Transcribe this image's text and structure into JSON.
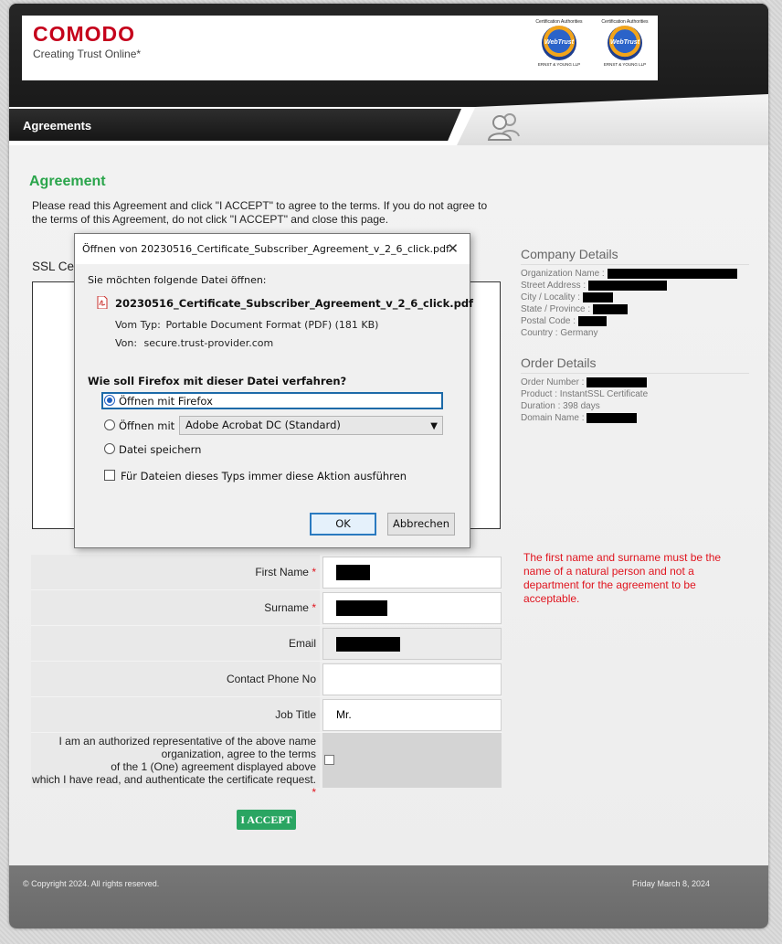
{
  "brand": {
    "name": "COMODO",
    "tagline": "Creating Trust Online*"
  },
  "seals": [
    {
      "caption": "Certification Authorities",
      "label": "WebTrust",
      "auditor": "ERNST & YOUNG LLP"
    },
    {
      "caption": "Certification Authorities",
      "label": "WebTrust",
      "auditor": "ERNST & YOUNG LLP"
    }
  ],
  "nav": {
    "title": "Agreements"
  },
  "page": {
    "title": "Agreement",
    "intro": "Please read this Agreement and click \"I ACCEPT\" to agree to the terms. If you do not agree to the terms of this Agreement, do not click \"I ACCEPT\" and close this page.",
    "ssl_heading": "SSL Ce"
  },
  "company": {
    "heading": "Company Details",
    "rows": [
      {
        "label": "Organization Name :",
        "value": ""
      },
      {
        "label": "Street Address :",
        "value": ""
      },
      {
        "label": "City / Locality :",
        "value": ""
      },
      {
        "label": "State / Province :",
        "value": ""
      },
      {
        "label": "Postal Code :",
        "value": ""
      },
      {
        "label": "Country : Germany",
        "value": ""
      }
    ]
  },
  "order": {
    "heading": "Order Details",
    "rows": [
      {
        "label": "Order Number :"
      },
      {
        "label": "Product : InstantSSL Certificate"
      },
      {
        "label": "Duration : 398 days"
      },
      {
        "label": "Domain Name :"
      }
    ]
  },
  "note": "The first name and surname must be the name of a natural person and not a department for the agreement to be acceptable.",
  "form": {
    "first_name": {
      "label": "First Name",
      "value": ""
    },
    "surname": {
      "label": "Surname",
      "value": ""
    },
    "email": {
      "label": "Email",
      "value": ""
    },
    "phone": {
      "label": "Contact Phone No",
      "value": ""
    },
    "job_title": {
      "label": "Job Title",
      "value": "Mr."
    },
    "authorize": {
      "line1": "I am an authorized representative of the above name",
      "line2": "organization, agree to the terms",
      "line3": "of the 1 (One) agreement displayed above",
      "line4": "which I have read, and authenticate the certificate request."
    },
    "required_mark": "*",
    "accept_label": "I ACCEPT"
  },
  "footer": {
    "copyright": "© Copyright 2024. All rights reserved.",
    "date": "Friday March 8, 2024"
  },
  "dialog": {
    "title": "Öffnen von 20230516_Certificate_Subscriber_Agreement_v_2_6_click.pdf",
    "close": "✕",
    "question1": "Sie möchten folgende Datei öffnen:",
    "filename": "20230516_Certificate_Subscriber_Agreement_v_2_6_click.pdf",
    "type_label": "Vom Typ:",
    "type_value": "Portable Document Format (PDF) (181 KB)",
    "from_label": "Von:",
    "from_value": "secure.trust-provider.com",
    "question2": "Wie soll Firefox mit dieser Datei verfahren?",
    "option_open_firefox": "Öffnen mit Firefox",
    "option_open_with": "Öffnen mit",
    "open_with_app": "Adobe Acrobat DC (Standard)",
    "option_save": "Datei speichern",
    "always_label": "Für Dateien dieses Typs immer diese Aktion ausführen",
    "ok": "OK",
    "cancel": "Abbrechen"
  }
}
